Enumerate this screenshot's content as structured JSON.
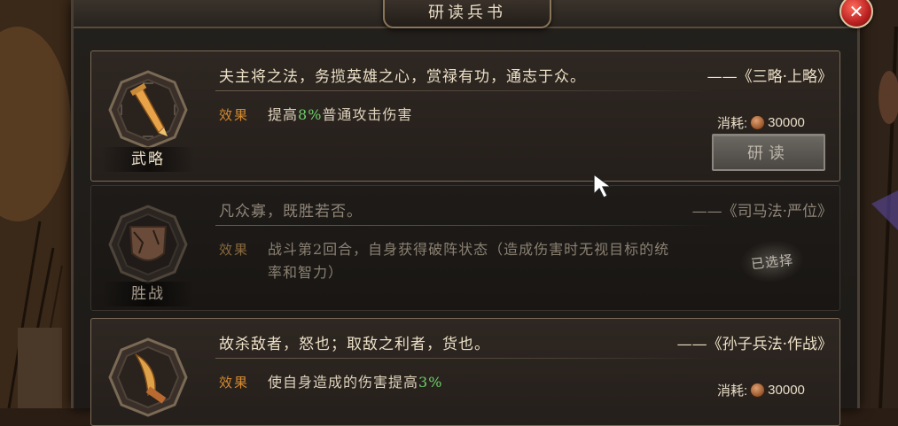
{
  "window": {
    "title": "研读兵书",
    "close_label": "✕"
  },
  "cards": [
    {
      "emblem_label": "武略",
      "quote": "夫主将之法，务揽英雄之心，赏禄有功，通志于众。",
      "source": "——《三略·上略》",
      "effect_label": "效果",
      "effect_prefix": "提高",
      "effect_highlight": "8%",
      "effect_suffix": "普通攻击伤害",
      "cost_label": "消耗:",
      "cost_value": "30000",
      "button_label": "研读",
      "state": "available"
    },
    {
      "emblem_label": "胜战",
      "quote": "凡众寡，既胜若否。",
      "source": "——《司马法·严位》",
      "effect_label": "效果",
      "effect_text": "战斗第2回合，自身获得破阵状态（造成伤害时无视目标的统率和智力）",
      "selected_label": "已选择",
      "state": "selected"
    },
    {
      "emblem_label": "",
      "quote": "故杀敌者，怒也；取敌之利者，货也。",
      "source": "——《孙子兵法·作战》",
      "effect_label": "效果",
      "effect_prefix": "使自身造成的伤害提高",
      "effect_highlight": "3%",
      "effect_suffix": "",
      "cost_label": "消耗:",
      "cost_value": "30000",
      "state": "available"
    }
  ],
  "colors": {
    "accent_effect": "#d68a2e",
    "highlight_value": "#6ed06a",
    "close_red": "#b82020"
  },
  "icons": [
    "close-icon",
    "sword-icon",
    "shield-icon",
    "dagger-icon",
    "coin-icon",
    "mouse-cursor-icon"
  ]
}
